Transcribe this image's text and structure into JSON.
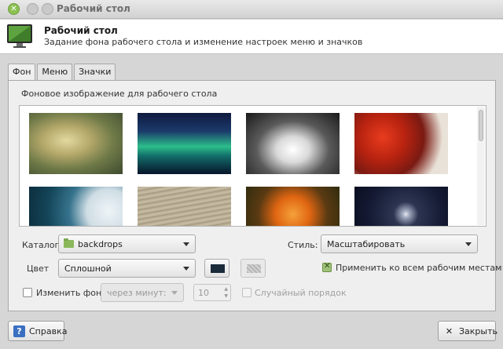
{
  "window": {
    "title": "Рабочий стол"
  },
  "header": {
    "title": "Рабочий стол",
    "subtitle": "Задание фона рабочего стола и изменение настроек меню и значков"
  },
  "tabs": [
    {
      "label": "Фон",
      "active": true
    },
    {
      "label": "Меню",
      "active": false
    },
    {
      "label": "Значки",
      "active": false
    }
  ],
  "background": {
    "section_label": "Фоновое изображение для рабочего стола",
    "wallpapers": [
      {
        "name": "grass-bokeh"
      },
      {
        "name": "aurora"
      },
      {
        "name": "waterfall"
      },
      {
        "name": "red-maple-leaves"
      },
      {
        "name": "blue-lens"
      },
      {
        "name": "zen-garden"
      },
      {
        "name": "orange-dandelion"
      },
      {
        "name": "moon-night"
      }
    ],
    "catalog_label": "Каталог",
    "catalog_value": "backdrops",
    "style_label": "Стиль:",
    "style_value": "Масштабировать",
    "color_label": "Цвет",
    "color_value": "Сплошной",
    "primary_color": "#1c2b3a",
    "apply_all_label": "Применить ко всем рабочим местам",
    "apply_all_checked": true,
    "change_bg_label": "Изменить фон",
    "change_bg_checked": false,
    "interval_value": "через минут:",
    "interval_number": "10",
    "random_label": "Случайный порядок",
    "random_checked": false
  },
  "buttons": {
    "help_label": "Справка",
    "close_label": "Закрыть"
  },
  "colors": {
    "accent": "#8cc153",
    "help_icon": "#3a6fc1"
  }
}
